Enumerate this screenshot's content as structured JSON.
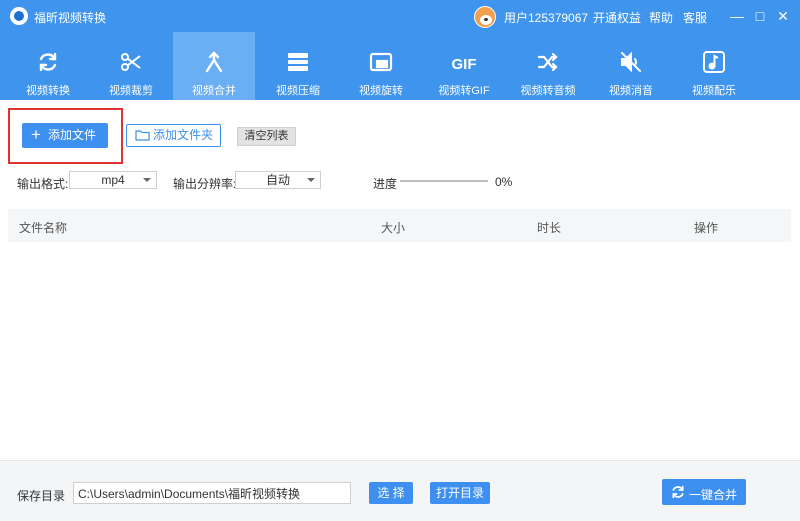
{
  "window": {
    "app_title": "福昕视频转换",
    "user_name": "用户125379067",
    "open_vip": "开通权益",
    "help": "帮助",
    "service": "客服",
    "min_glyph": "—",
    "max_glyph": "□",
    "close_glyph": "✕"
  },
  "toolbar": [
    {
      "label": "视频转换",
      "icon": "refresh-icon"
    },
    {
      "label": "视频裁剪",
      "icon": "scissors-icon"
    },
    {
      "label": "视频合并",
      "icon": "merge-icon",
      "active": true
    },
    {
      "label": "视频压缩",
      "icon": "compress-icon"
    },
    {
      "label": "视频旋转",
      "icon": "rotate-icon"
    },
    {
      "label": "视频转GIF",
      "icon": "gif-icon",
      "icon_text": "GIF"
    },
    {
      "label": "视频转音频",
      "icon": "shuffle-icon"
    },
    {
      "label": "视频消音",
      "icon": "mute-icon"
    },
    {
      "label": "视频配乐",
      "icon": "music-icon"
    }
  ],
  "actions": {
    "add_file": "添加文件",
    "add_folder": "添加文件夹",
    "clear_list": "清空列表"
  },
  "options": {
    "format_label": "输出格式:",
    "format_value": "mp4",
    "resolution_label": "输出分辨率:",
    "resolution_value": "自动",
    "progress_label": "进度",
    "progress_percent": "0%",
    "progress_fraction": 0
  },
  "table": {
    "headers": [
      "文件名称",
      "大小",
      "时长",
      "操作"
    ],
    "rows": []
  },
  "footer": {
    "save_label": "保存目录",
    "save_path": "C:\\Users\\admin\\Documents\\福昕视频转换",
    "choose": "选 择",
    "open_dir": "打开目录",
    "merge": "一键合并"
  },
  "colors": {
    "primary": "#3f94ee",
    "active_tab": "#6aaef3",
    "button_blue": "#3d8ff0",
    "highlight": "#e0322e"
  }
}
